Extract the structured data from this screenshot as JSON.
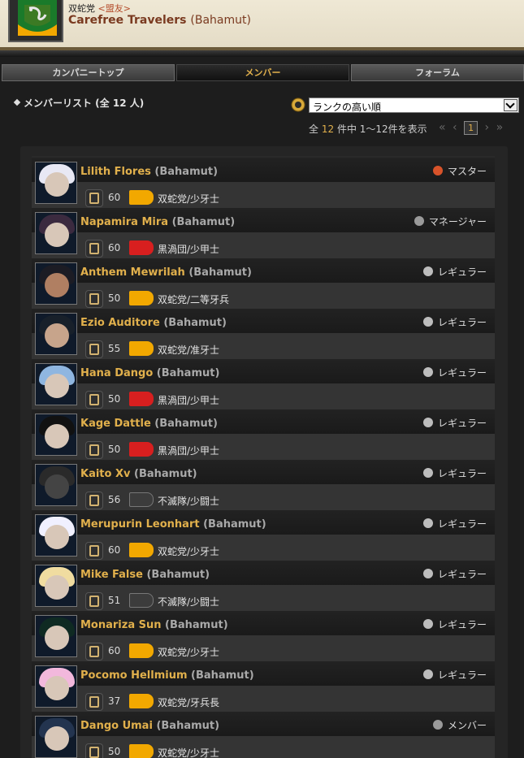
{
  "header": {
    "company_line": "双蛇党",
    "ally_tag": "<盟友>",
    "fc_name": "Carefree Travelers",
    "fc_world": "(Bahamut)"
  },
  "tabs": [
    {
      "label": "カンパニートップ",
      "active": false
    },
    {
      "label": "メンバー",
      "active": true
    },
    {
      "label": "フォーラム",
      "active": false
    }
  ],
  "toolbar": {
    "title": "メンバーリスト (全 12 人)",
    "sort_value": "ランクの高い順"
  },
  "pager": {
    "prefix": "全",
    "count": "12",
    "suffix": "件中 1〜12件を表示",
    "first": "«",
    "prev": "‹",
    "current": "1",
    "next": "›",
    "last": "»"
  },
  "colors": {
    "accent": "#e1b04c",
    "snake": "#f2a800",
    "flame": "#d81f1f",
    "maelstrom": "#3c3c3c"
  },
  "members": [
    {
      "name": "Lilith Flores",
      "world": "(Bahamut)",
      "rank": "マスター",
      "rank_icon": "master-icon",
      "level": "60",
      "gc": "双蛇党/少牙士",
      "gc_color": "#f2a800",
      "job_icon": "conjurer-icon"
    },
    {
      "name": "Napamira Mira",
      "world": "(Bahamut)",
      "rank": "マネージャー",
      "rank_icon": "manager-icon",
      "level": "60",
      "gc": "黒渦団/少甲士",
      "gc_color": "#d81f1f",
      "job_icon": "pickaxe-icon"
    },
    {
      "name": "Anthem Mewrilah",
      "world": "(Bahamut)",
      "rank": "レギュラー",
      "rank_icon": "regular-icon",
      "level": "50",
      "gc": "双蛇党/二等牙兵",
      "gc_color": "#f2a800",
      "job_icon": "spear-icon"
    },
    {
      "name": "Ezio Auditore",
      "world": "(Bahamut)",
      "rank": "レギュラー",
      "rank_icon": "regular-icon",
      "level": "55",
      "gc": "双蛇党/准牙士",
      "gc_color": "#f2a800",
      "job_icon": "armor-icon"
    },
    {
      "name": "Hana Dango",
      "world": "(Bahamut)",
      "rank": "レギュラー",
      "rank_icon": "regular-icon",
      "level": "50",
      "gc": "黒渦団/少甲士",
      "gc_color": "#d81f1f",
      "job_icon": "armor-icon"
    },
    {
      "name": "Kage Dattle",
      "world": "(Bahamut)",
      "rank": "レギュラー",
      "rank_icon": "regular-icon",
      "level": "50",
      "gc": "黒渦団/少甲士",
      "gc_color": "#d81f1f",
      "job_icon": "armor-icon"
    },
    {
      "name": "Kaito Xv",
      "world": "(Bahamut)",
      "rank": "レギュラー",
      "rank_icon": "regular-icon",
      "level": "56",
      "gc": "不滅隊/少闘士",
      "gc_color": "#3c3c3c",
      "job_icon": "spiral-icon"
    },
    {
      "name": "Merupurin Leonhart",
      "world": "(Bahamut)",
      "rank": "レギュラー",
      "rank_icon": "regular-icon",
      "level": "60",
      "gc": "双蛇党/少牙士",
      "gc_color": "#f2a800",
      "job_icon": "spear-icon"
    },
    {
      "name": "Mike False",
      "world": "(Bahamut)",
      "rank": "レギュラー",
      "rank_icon": "regular-icon",
      "level": "51",
      "gc": "不滅隊/少闘士",
      "gc_color": "#3c3c3c",
      "job_icon": "goggles-icon"
    },
    {
      "name": "Monariza Sun",
      "world": "(Bahamut)",
      "rank": "レギュラー",
      "rank_icon": "regular-icon",
      "level": "60",
      "gc": "双蛇党/少牙士",
      "gc_color": "#f2a800",
      "job_icon": "scythe-icon"
    },
    {
      "name": "Pocomo Hellmium",
      "world": "(Bahamut)",
      "rank": "レギュラー",
      "rank_icon": "regular-icon",
      "level": "37",
      "gc": "双蛇党/牙兵長",
      "gc_color": "#f2a800",
      "job_icon": "armor-icon"
    },
    {
      "name": "Dango Umai",
      "world": "(Bahamut)",
      "rank": "メンバー",
      "rank_icon": "member-icon",
      "level": "50",
      "gc": "双蛇党/少牙士",
      "gc_color": "#f2a800",
      "job_icon": "armor-icon"
    }
  ]
}
